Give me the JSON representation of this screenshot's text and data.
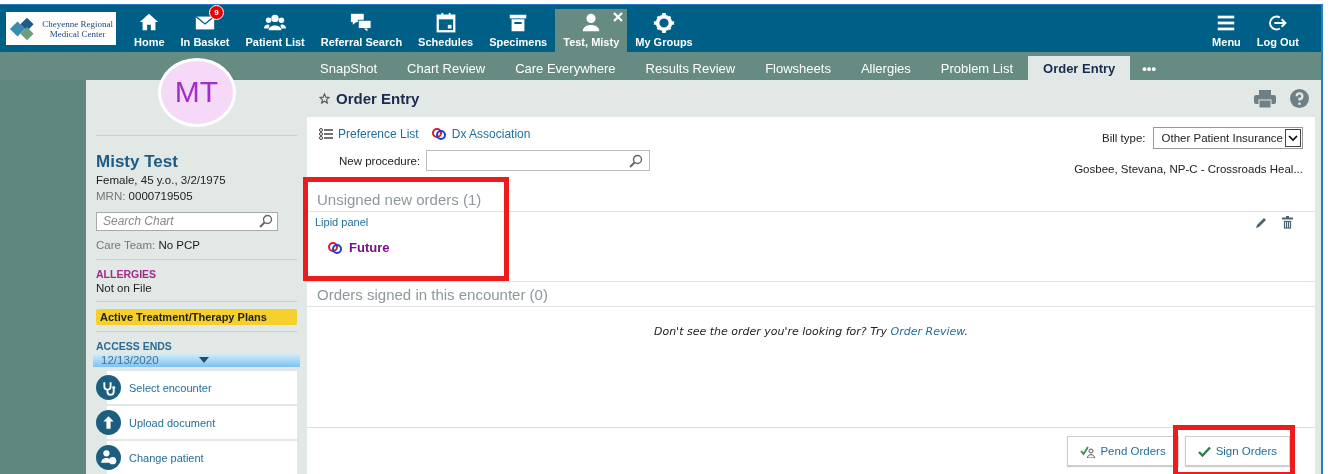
{
  "logo": {
    "lines": [
      "Cheyenne Regional",
      "Medical Center"
    ]
  },
  "nav": [
    {
      "label": "Home",
      "selected": false,
      "closable": false
    },
    {
      "label": "In Basket",
      "badge": "9",
      "selected": false,
      "closable": false
    },
    {
      "label": "Patient List",
      "selected": false,
      "closable": false
    },
    {
      "label": "Referral Search",
      "selected": false,
      "closable": false
    },
    {
      "label": "Schedules",
      "selected": false,
      "closable": false
    },
    {
      "label": "Specimens",
      "selected": false,
      "closable": false
    },
    {
      "label": "Test, Misty",
      "selected": true,
      "closable": true
    },
    {
      "label": "My Groups",
      "selected": false,
      "closable": false
    }
  ],
  "nav_right": [
    {
      "label": "Menu"
    },
    {
      "label": "Log Out"
    }
  ],
  "tabs": [
    {
      "label": "SnapShot",
      "selected": false
    },
    {
      "label": "Chart Review",
      "selected": false
    },
    {
      "label": "Care Everywhere",
      "selected": false
    },
    {
      "label": "Results Review",
      "selected": false
    },
    {
      "label": "Flowsheets",
      "selected": false
    },
    {
      "label": "Allergies",
      "selected": false
    },
    {
      "label": "Problem List",
      "selected": false
    },
    {
      "label": "Order Entry",
      "selected": true
    }
  ],
  "more_tabs": "•••",
  "patient": {
    "initials": "MT",
    "name": "Misty Test",
    "demographics": "Female, 45 y.o., 3/2/1975",
    "mrn_label": "MRN:",
    "mrn": "0000719505",
    "search_placeholder": "Search Chart",
    "care_team_label": "Care Team:",
    "care_team": "No PCP",
    "allergies_heading": "ALLERGIES",
    "allergies": "Not on File",
    "plans_badge": "Active Treatment/Therapy Plans",
    "access_heading": "ACCESS ENDS",
    "access_date": "12/13/2020",
    "actions": [
      {
        "label": "Select encounter"
      },
      {
        "label": "Upload document"
      },
      {
        "label": "Change patient"
      }
    ]
  },
  "activity": {
    "title": "Order Entry",
    "links": [
      "Preference List",
      "Dx Association"
    ],
    "procedure_label": "New procedure:",
    "bill_type_label": "Bill type:",
    "bill_type": "Other Patient Insurance",
    "provider": "Gosbee, Stevana, NP-C - Crossroads Heal...",
    "sections": [
      {
        "heading": "Unsigned new orders (1)",
        "orders": [
          {
            "name": "Lipid panel",
            "status": "Future"
          }
        ]
      },
      {
        "heading": "Orders signed in this encounter (0)"
      }
    ],
    "hint": "Don't see the order you're looking for? Try ",
    "hint_link": "Order Review",
    "hint_end": ".",
    "buttons": [
      "Pend Orders",
      "Sign Orders"
    ]
  }
}
